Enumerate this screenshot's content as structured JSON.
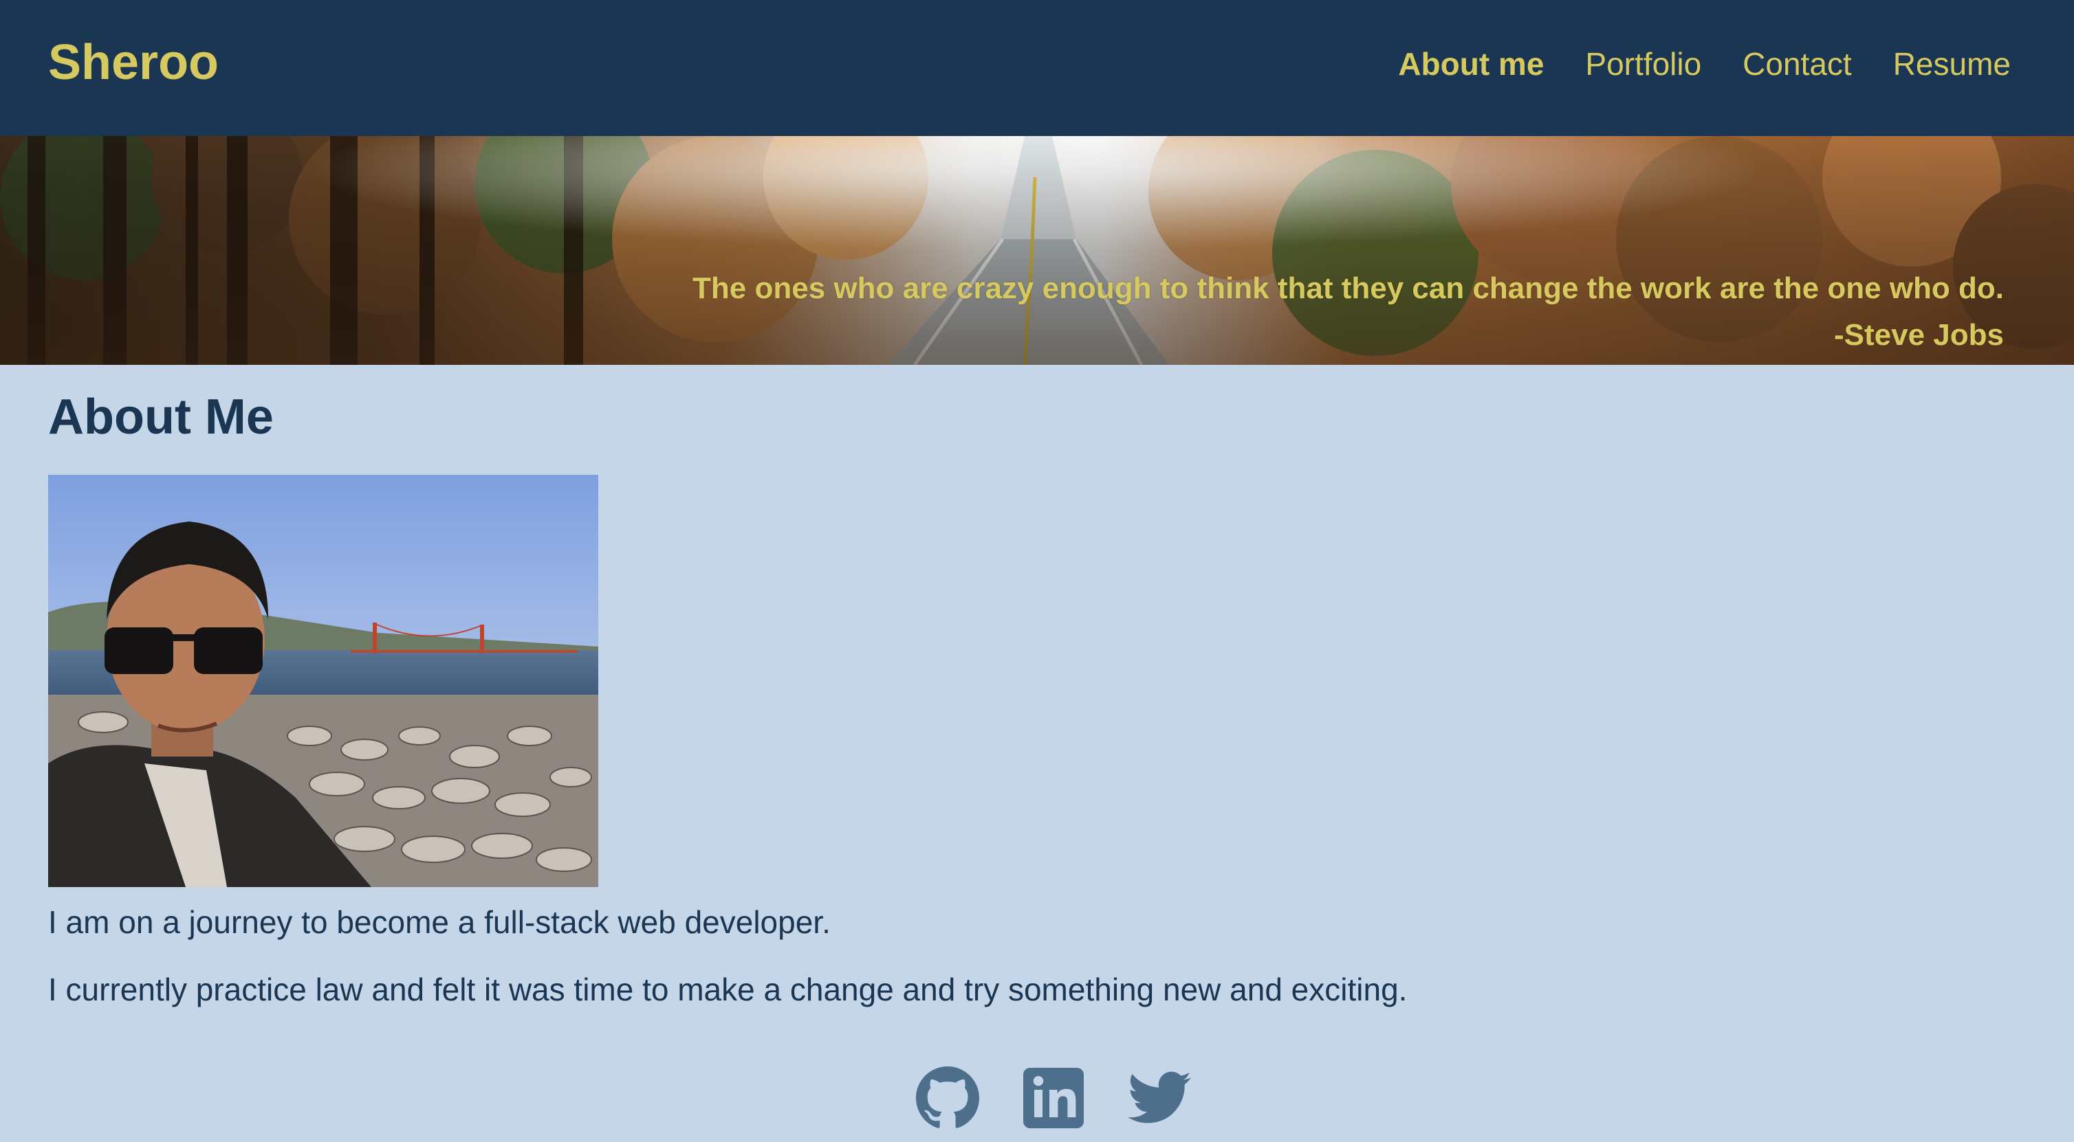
{
  "header": {
    "brand": "Sheroo",
    "nav": [
      {
        "label": "About me",
        "active": true
      },
      {
        "label": "Portfolio",
        "active": false
      },
      {
        "label": "Contact",
        "active": false
      },
      {
        "label": "Resume",
        "active": false
      }
    ]
  },
  "hero": {
    "quote": "The ones who are crazy enough to think that they can change the work are the one who do.",
    "author": "-Steve Jobs",
    "image": "autumn-forest-road"
  },
  "about": {
    "title": "About Me",
    "photo": "profile-selfie-golden-gate",
    "paragraphs": [
      "I am on a journey to become a full-stack web developer.",
      "I currently practice law and felt it was time to make a change and try something new and exciting."
    ]
  },
  "social": [
    {
      "icon": "github-icon"
    },
    {
      "icon": "linkedin-icon"
    },
    {
      "icon": "twitter-icon"
    }
  ],
  "colors": {
    "nav_bg": "#1a3653",
    "accent": "#d5c95f",
    "page_bg": "#c5d6e8",
    "text": "#1a3653",
    "icon": "#4e6f8c"
  }
}
